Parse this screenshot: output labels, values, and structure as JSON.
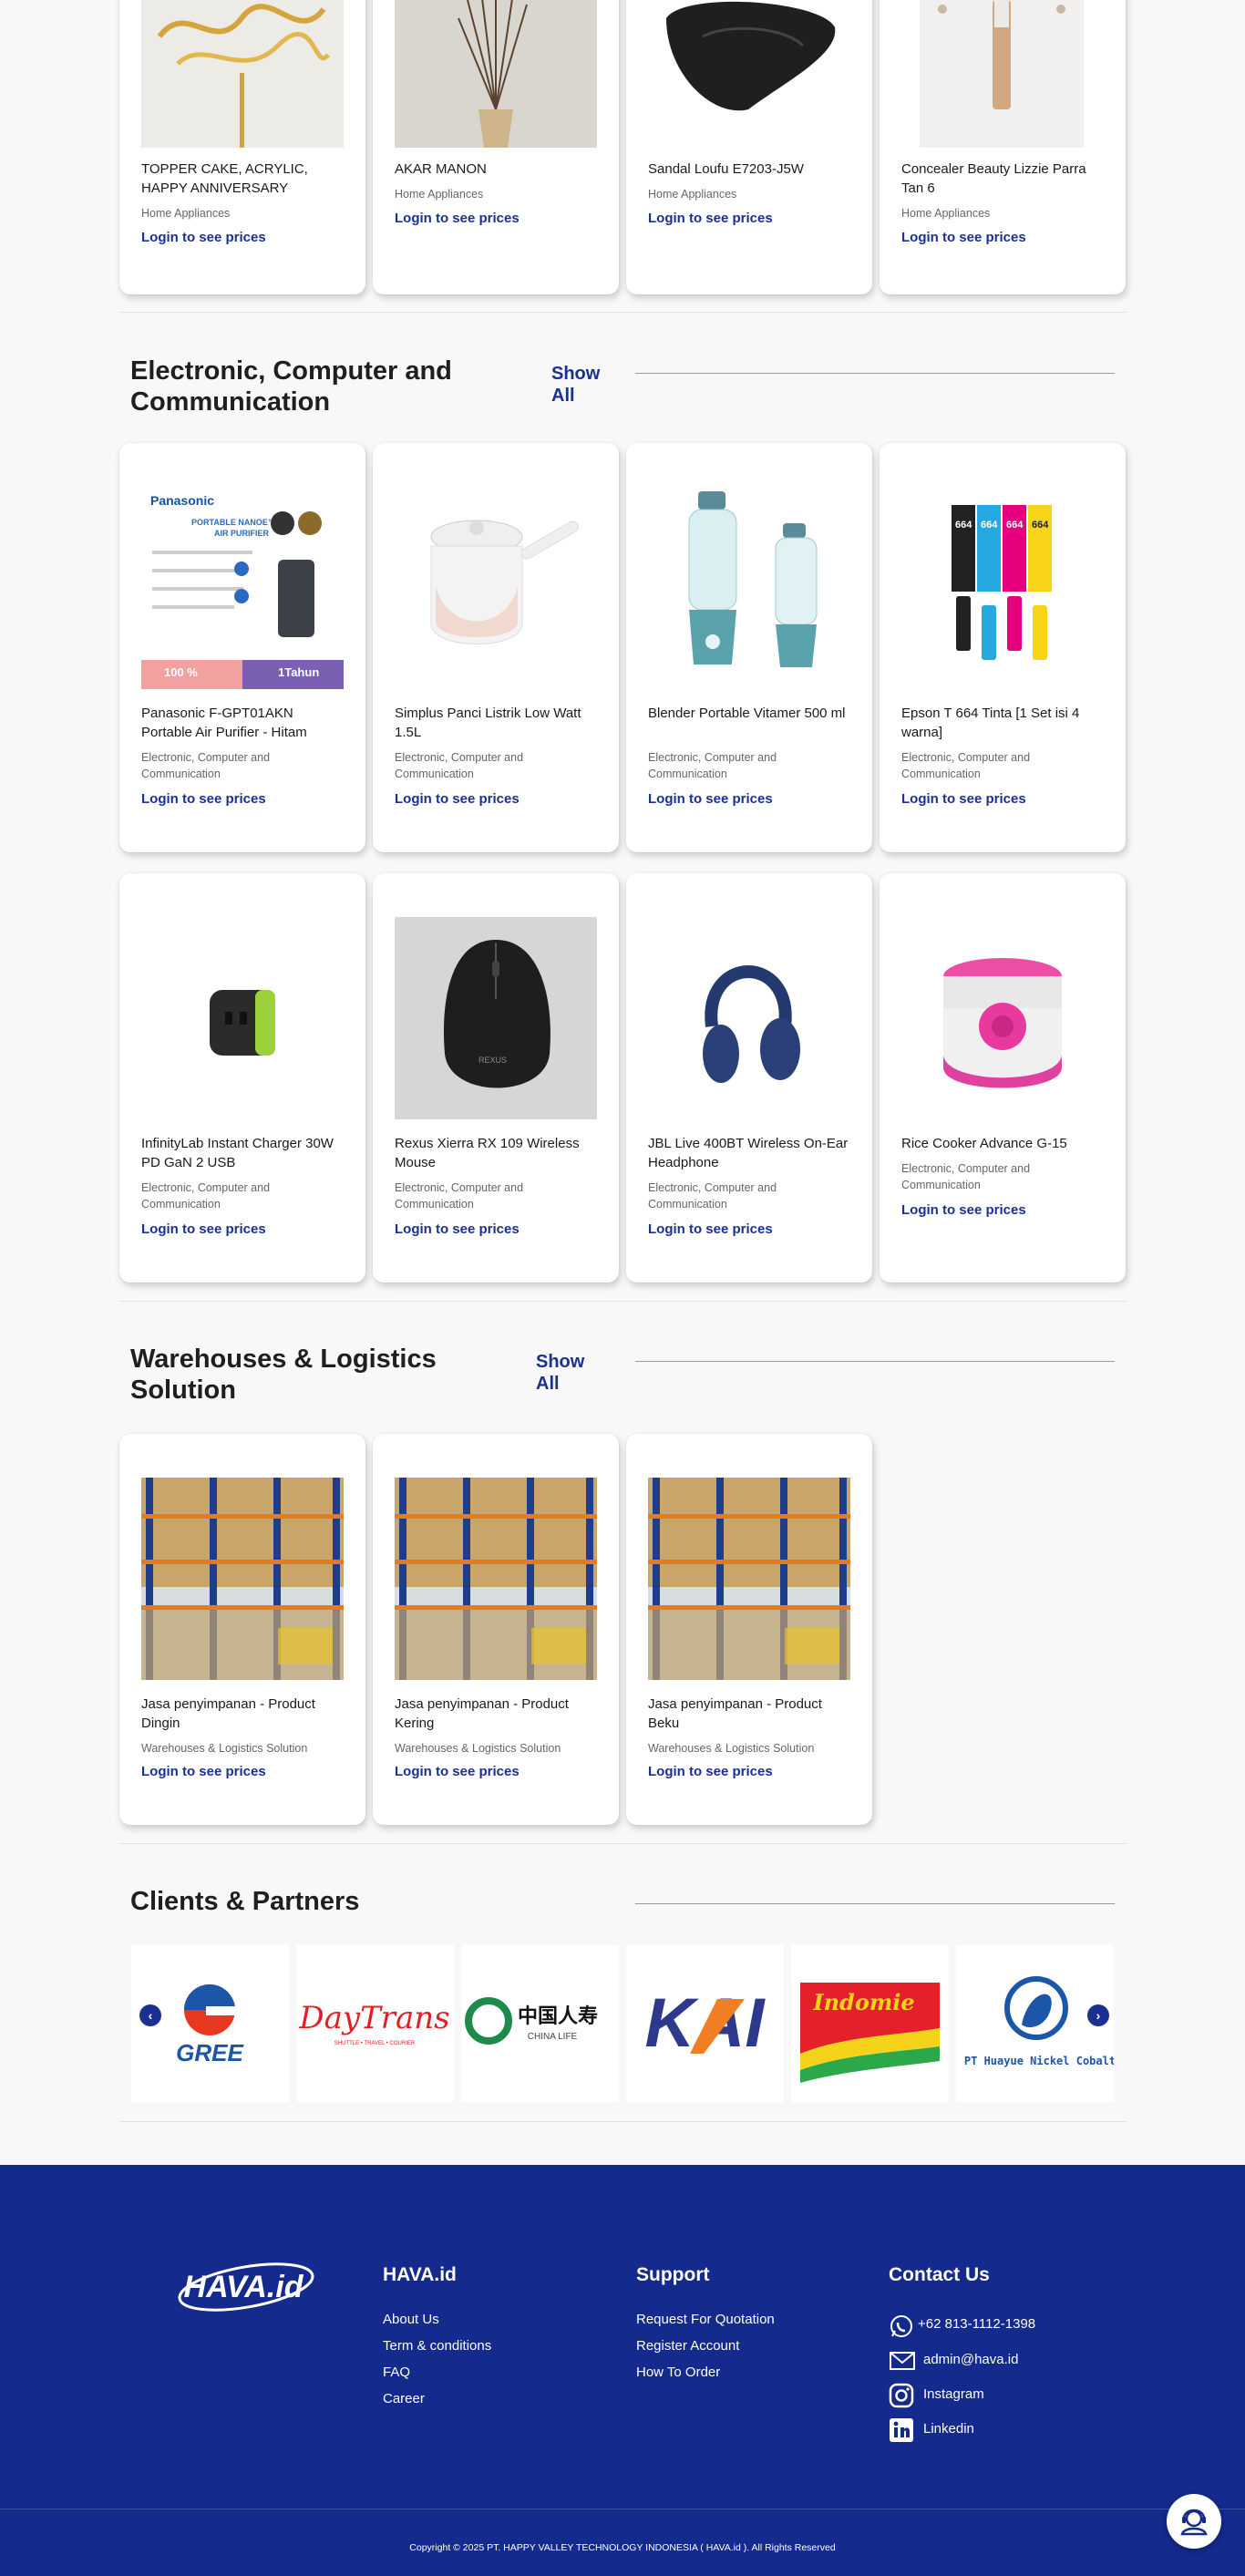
{
  "sections": {
    "home_appliances_tail": {
      "products": [
        {
          "name": "TOPPER CAKE, ACRYLIC, HAPPY ANNIVERSARY",
          "category": "Home Appliances",
          "price": "Login to see prices"
        },
        {
          "name": "AKAR MANON",
          "category": "Home Appliances",
          "price": "Login to see prices"
        },
        {
          "name": "Sandal Loufu E7203-J5W",
          "category": "Home Appliances",
          "price": "Login to see prices"
        },
        {
          "name": "Concealer Beauty Lizzie Parra Tan 6",
          "category": "Home Appliances",
          "price": "Login to see prices"
        }
      ]
    },
    "electronic": {
      "title": "Electronic, Computer and Communication",
      "show_all": "Show All",
      "products": [
        {
          "name": "Panasonic F-GPT01AKN Portable Air Purifier - Hitam",
          "category": "Electronic, Computer and Communication",
          "price": "Login to see prices"
        },
        {
          "name": "Simplus Panci Listrik Low Watt 1.5L",
          "category": "Electronic, Computer and Communication",
          "price": "Login to see prices"
        },
        {
          "name": "Blender Portable Vitamer 500 ml",
          "category": "Electronic, Computer and Communication",
          "price": "Login to see prices"
        },
        {
          "name": "Epson T 664 Tinta [1 Set isi 4 warna]",
          "category": "Electronic, Computer and Communication",
          "price": "Login to see prices"
        },
        {
          "name": "InfinityLab Instant Charger 30W PD GaN 2 USB",
          "category": "Electronic, Computer and Communication",
          "price": "Login to see prices"
        },
        {
          "name": "Rexus Xierra RX 109 Wireless Mouse",
          "category": "Electronic, Computer and Communication",
          "price": "Login to see prices"
        },
        {
          "name": "JBL Live 400BT Wireless On-Ear Headphone",
          "category": "Electronic, Computer and Communication",
          "price": "Login to see prices"
        },
        {
          "name": "Rice Cooker Advance G-15",
          "category": "Electronic, Computer and Communication",
          "price": "Login to see prices"
        }
      ],
      "image_text": {
        "panasonic_brand": "Panasonic",
        "panasonic_line1": "PORTABLE NANOE™X",
        "panasonic_line2": "AIR PURIFIER",
        "panasonic_badge1": "100 %",
        "panasonic_badge2": "1Tahun",
        "epson_num": "664",
        "mouse_brand": "REXUS"
      }
    },
    "warehouse": {
      "title": "Warehouses & Logistics Solution",
      "show_all": "Show All",
      "products": [
        {
          "name": "Jasa penyimpanan - Product Dingin",
          "category": "Warehouses & Logistics Solution",
          "price": "Login to see prices"
        },
        {
          "name": "Jasa penyimpanan - Product Kering",
          "category": "Warehouses & Logistics Solution",
          "price": "Login to see prices"
        },
        {
          "name": "Jasa penyimpanan - Product Beku",
          "category": "Warehouses & Logistics Solution",
          "price": "Login to see prices"
        }
      ]
    },
    "clients": {
      "title": "Clients & Partners",
      "prev_icon": "chevron-left-icon",
      "next_icon": "chevron-right-icon",
      "logos": [
        {
          "name": "GREE"
        },
        {
          "name": "DayTrans",
          "sub": "SHUTTLE • TRAVEL • COURIER"
        },
        {
          "name": "中国人寿",
          "sub": "CHINA LIFE"
        },
        {
          "name": "KAI"
        },
        {
          "name": "Indomie"
        },
        {
          "name": "PT Huayue Nickel Cobalt"
        }
      ]
    }
  },
  "footer": {
    "logo_text": "HAVA.id",
    "col1": {
      "heading": "HAVA.id",
      "links": [
        "About Us",
        "Term & conditions",
        "FAQ",
        "Career"
      ]
    },
    "col2": {
      "heading": "Support",
      "links": [
        "Request For Quotation",
        "Register Account",
        "How To Order"
      ]
    },
    "col3": {
      "heading": "Contact Us",
      "items": [
        {
          "icon": "whatsapp-icon",
          "text": "+62 813-1112-1398"
        },
        {
          "icon": "email-icon",
          "text": "admin@hava.id"
        },
        {
          "icon": "instagram-icon",
          "text": "Instagram"
        },
        {
          "icon": "linkedin-icon",
          "text": "Linkedin"
        }
      ]
    },
    "copyright": "Copyright © 2025 PT. HAPPY VALLEY TECHNOLOGY INDONESIA ( HAVA.id ). All Rights Reserved",
    "chat_icon": "support-agent-icon"
  },
  "colors": {
    "brand": "#1a3191",
    "footer_bg": "#142a8c",
    "page_bg": "#f8f8f8"
  }
}
